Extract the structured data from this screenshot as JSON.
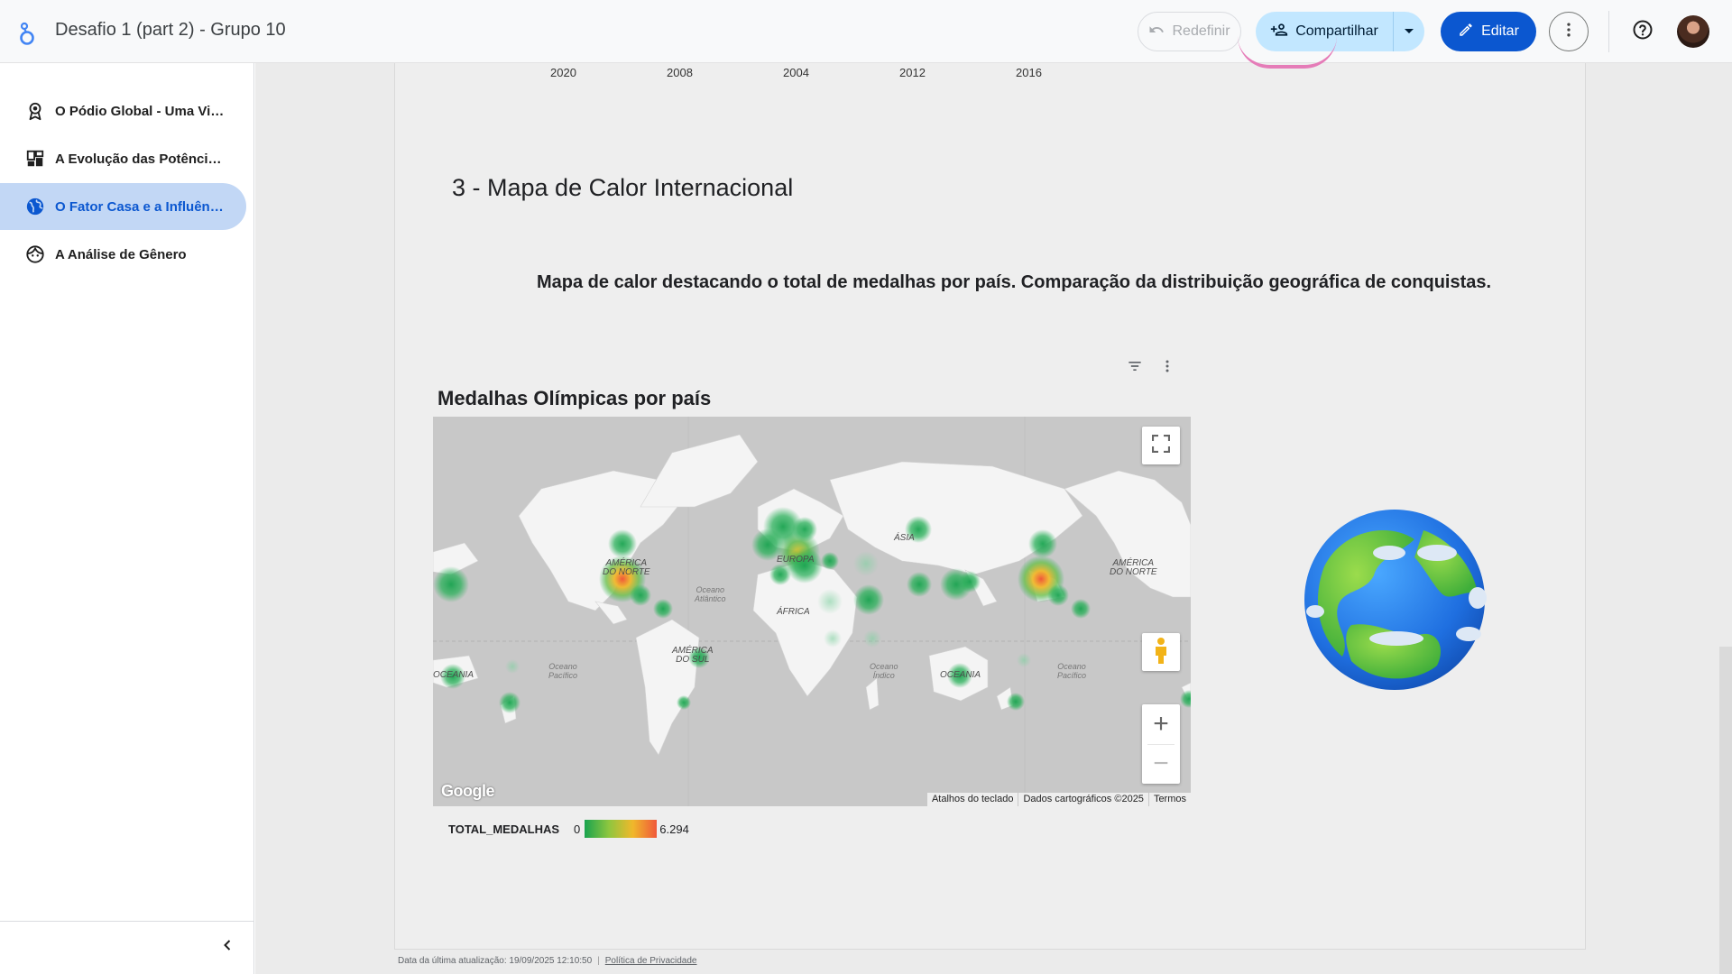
{
  "header": {
    "title": "Desafio 1 (part 2) - Grupo 10",
    "reset_label": "Redefinir",
    "share_label": "Compartilhar",
    "edit_label": "Editar"
  },
  "sidebar": {
    "items": [
      {
        "label": "O Pódio Global - Uma Vi…",
        "icon": "medal-icon",
        "active": false
      },
      {
        "label": "A Evolução das Potência…",
        "icon": "dashboard-icon",
        "active": false
      },
      {
        "label": "O Fator Casa e a Influên…",
        "icon": "globe-icon",
        "active": true
      },
      {
        "label": "A Análise de Gênero",
        "icon": "face-icon",
        "active": false
      }
    ]
  },
  "previous_chart": {
    "x_ticks": [
      "2020",
      "2008",
      "2004",
      "2012",
      "2016"
    ]
  },
  "section": {
    "title": "3 - Mapa de Calor Internacional",
    "description": "Mapa de calor destacando o total de medalhas por país. Comparação da distribuição geográfica de conquistas."
  },
  "map_chart": {
    "title": "Medalhas Olímpicas por país",
    "continent_labels": {
      "north_america_1": "AMÉRICA\nDO NORTE",
      "europe": "EUROPA",
      "asia": "ÁSIA",
      "africa": "ÁFRICA",
      "south_america": "AMÉRICA\nDO SUL",
      "oceania_1": "OCEANIA",
      "oceania_2": "OCEANIA",
      "north_america_2": "AMÉRICA\nDO NORTE"
    },
    "ocean_labels": {
      "atlantic": "Oceano\nAtlântico",
      "pacific_1": "Oceano\nPacífico",
      "indian": "Oceano\nÍndico",
      "pacific_2": "Oceano\nPacífico"
    },
    "google_logo": "Google",
    "attribution": {
      "shortcuts": "Atalhos do teclado",
      "map_data": "Dados cartográficos ©2025",
      "terms": "Termos"
    },
    "legend": {
      "metric": "TOTAL_MEDALHAS",
      "min": "0",
      "max": "6.294"
    },
    "colors": {
      "low": "#19a34f",
      "mid": "#f0b82b",
      "high": "#f0583a"
    }
  },
  "footer": {
    "last_update": "Data da última atualização: 19/09/2025 12:10:50",
    "privacy": "Política de Privacidade"
  }
}
